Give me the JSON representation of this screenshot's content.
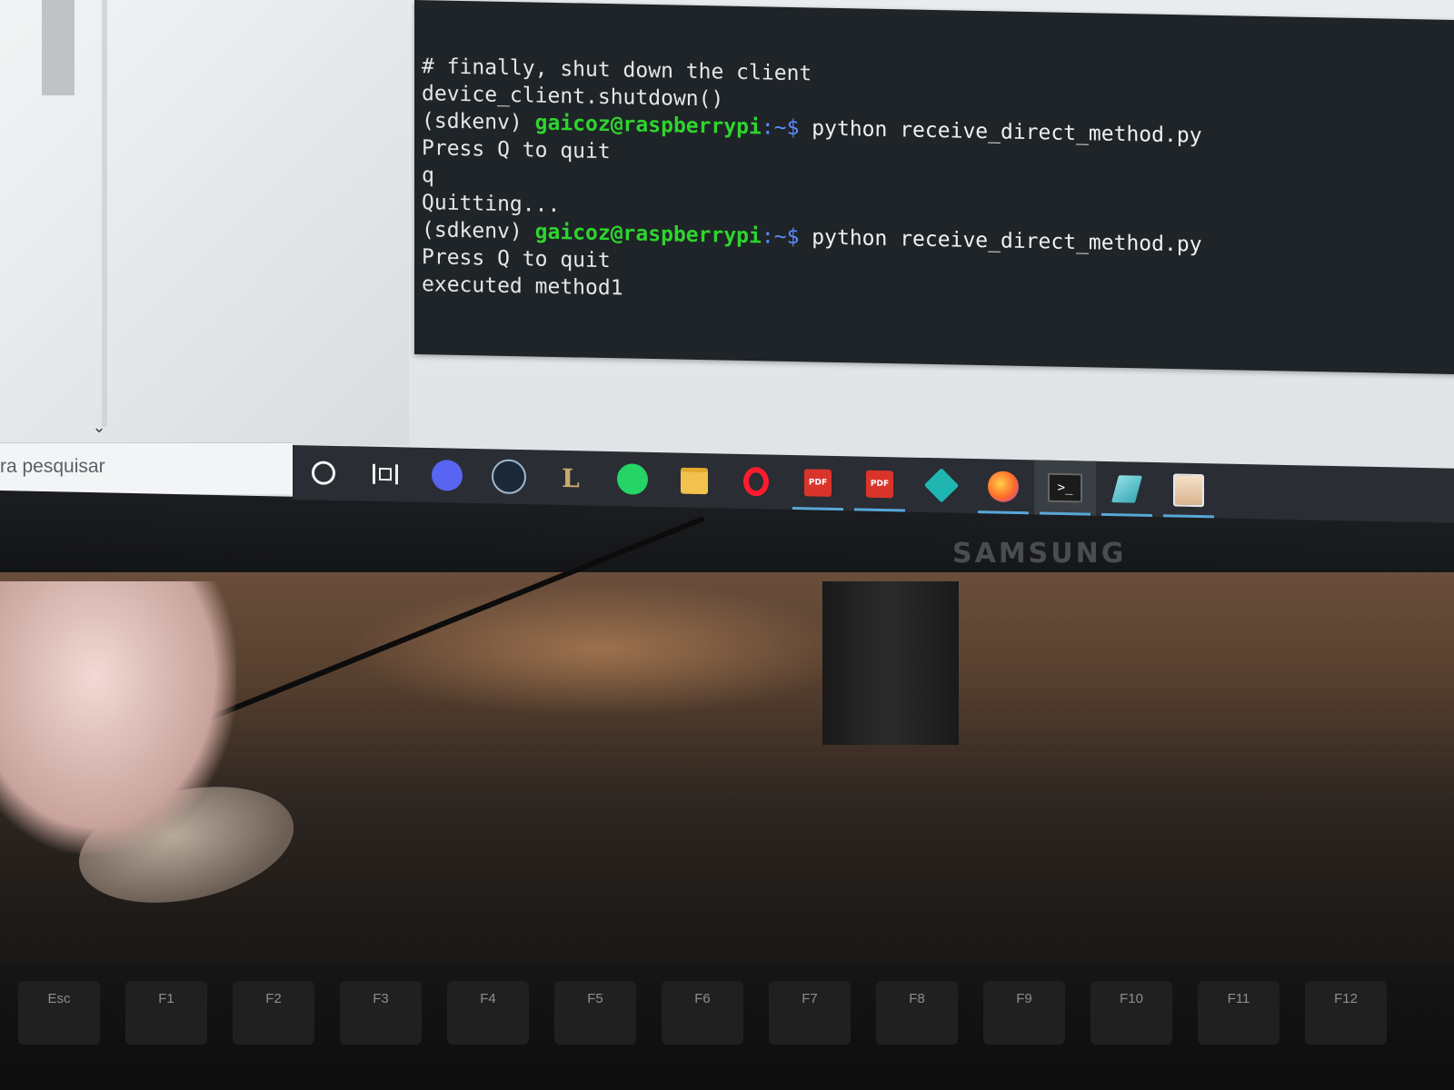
{
  "terminal": {
    "lines": [
      {
        "type": "text",
        "text": "# finally, shut down the client"
      },
      {
        "type": "text",
        "text": "device_client.shutdown()"
      },
      {
        "type": "prompt",
        "env": "(sdkenv)",
        "user": "gaicoz@raspberrypi",
        "path": ":~",
        "dollar": "$",
        "cmd": "python receive_direct_method.py"
      },
      {
        "type": "text",
        "text": "Press Q to quit"
      },
      {
        "type": "text",
        "text": "q"
      },
      {
        "type": "text",
        "text": "Quitting..."
      },
      {
        "type": "prompt",
        "env": "(sdkenv)",
        "user": "gaicoz@raspberrypi",
        "path": ":~",
        "dollar": "$",
        "cmd": "python receive_direct_method.py"
      },
      {
        "type": "text",
        "text": "Press Q to quit"
      },
      {
        "type": "text",
        "text": "executed method1"
      }
    ]
  },
  "taskbar": {
    "search_text": "ra pesquisar",
    "chevron": "⌄",
    "items": [
      {
        "name": "cortana-icon",
        "icon": "ico-circle",
        "glyph": "",
        "active": false,
        "running": false
      },
      {
        "name": "task-view-icon",
        "icon": "ico-taskview",
        "glyph": "",
        "active": false,
        "running": false
      },
      {
        "name": "discord-icon",
        "icon": "ico-discord",
        "glyph": "",
        "active": false,
        "running": false
      },
      {
        "name": "steam-icon",
        "icon": "ico-steam",
        "glyph": "",
        "active": false,
        "running": false
      },
      {
        "name": "league-of-legends-icon",
        "icon": "ico-lol",
        "glyph": "L",
        "active": false,
        "running": false
      },
      {
        "name": "whatsapp-icon",
        "icon": "ico-whatsapp",
        "glyph": "",
        "active": false,
        "running": false
      },
      {
        "name": "file-explorer-icon",
        "icon": "ico-folder",
        "glyph": "",
        "active": false,
        "running": false
      },
      {
        "name": "opera-icon",
        "icon": "ico-opera",
        "glyph": "",
        "active": false,
        "running": false
      },
      {
        "name": "pdf-viewer-icon",
        "icon": "ico-pdf",
        "glyph": "PDF",
        "active": false,
        "running": true
      },
      {
        "name": "pdf-viewer-icon",
        "icon": "ico-pdf",
        "glyph": "PDF",
        "active": false,
        "running": true
      },
      {
        "name": "3d-cube-app-icon",
        "icon": "ico-cube",
        "glyph": "",
        "active": false,
        "running": false
      },
      {
        "name": "firefox-icon",
        "icon": "ico-firefox",
        "glyph": "",
        "active": false,
        "running": true
      },
      {
        "name": "terminal-icon",
        "icon": "ico-terminal",
        "glyph": ">_",
        "active": true,
        "running": true
      },
      {
        "name": "notes-app-icon",
        "icon": "ico-note",
        "glyph": "",
        "active": false,
        "running": true
      },
      {
        "name": "avatar-app-icon",
        "icon": "ico-avatar",
        "glyph": "",
        "active": false,
        "running": true
      }
    ]
  },
  "monitor": {
    "brand": "SAMSUNG"
  },
  "keyboard": {
    "keys": [
      "Esc",
      "F1",
      "F2",
      "F3",
      "F4",
      "F5",
      "F6",
      "F7",
      "F8",
      "F9",
      "F10",
      "F11",
      "F12"
    ]
  },
  "colors": {
    "prompt_user": "#2ed52e",
    "prompt_dollar": "#5b8cff",
    "taskbar": "#2a2d33",
    "terminal_bg": "#1f2428"
  }
}
